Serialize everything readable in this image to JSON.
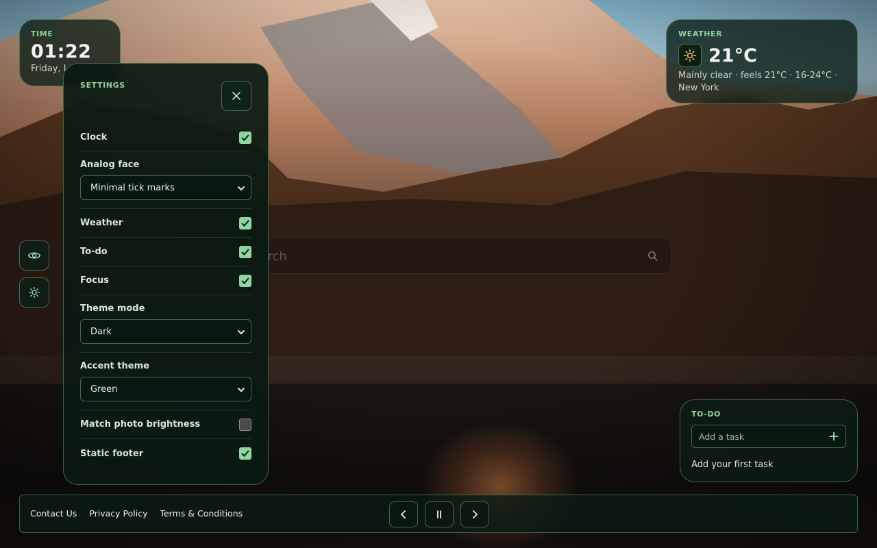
{
  "time": {
    "label": "TIME",
    "clock": "01:22",
    "date": "Friday, I"
  },
  "weather": {
    "label": "WEATHER",
    "icon": "sun-icon",
    "temperature": "21°C",
    "description": "Mainly clear · feels 21°C · 16-24°C ·",
    "location": "New York"
  },
  "search": {
    "placeholder": "Search"
  },
  "settings": {
    "title": "SETTINGS",
    "clock": {
      "label": "Clock",
      "checked": true
    },
    "analog_face": {
      "label": "Analog face",
      "value": "Minimal tick marks"
    },
    "weather": {
      "label": "Weather",
      "checked": true
    },
    "todo": {
      "label": "To-do",
      "checked": true
    },
    "focus": {
      "label": "Focus",
      "checked": true
    },
    "theme_mode": {
      "label": "Theme mode",
      "value": "Dark"
    },
    "accent_theme": {
      "label": "Accent theme",
      "value": "Green"
    },
    "match_brightness": {
      "label": "Match photo brightness",
      "checked": false
    },
    "static_footer": {
      "label": "Static footer",
      "checked": true
    }
  },
  "todo": {
    "label": "TO-DO",
    "placeholder": "Add a task",
    "empty_text": "Add your first task"
  },
  "footer": {
    "links": [
      "Contact Us",
      "Privacy Policy",
      "Terms & Conditions"
    ]
  },
  "colors": {
    "accent": "#8fd7a0",
    "panel": "#0a1a12",
    "border": "#78be8c"
  }
}
